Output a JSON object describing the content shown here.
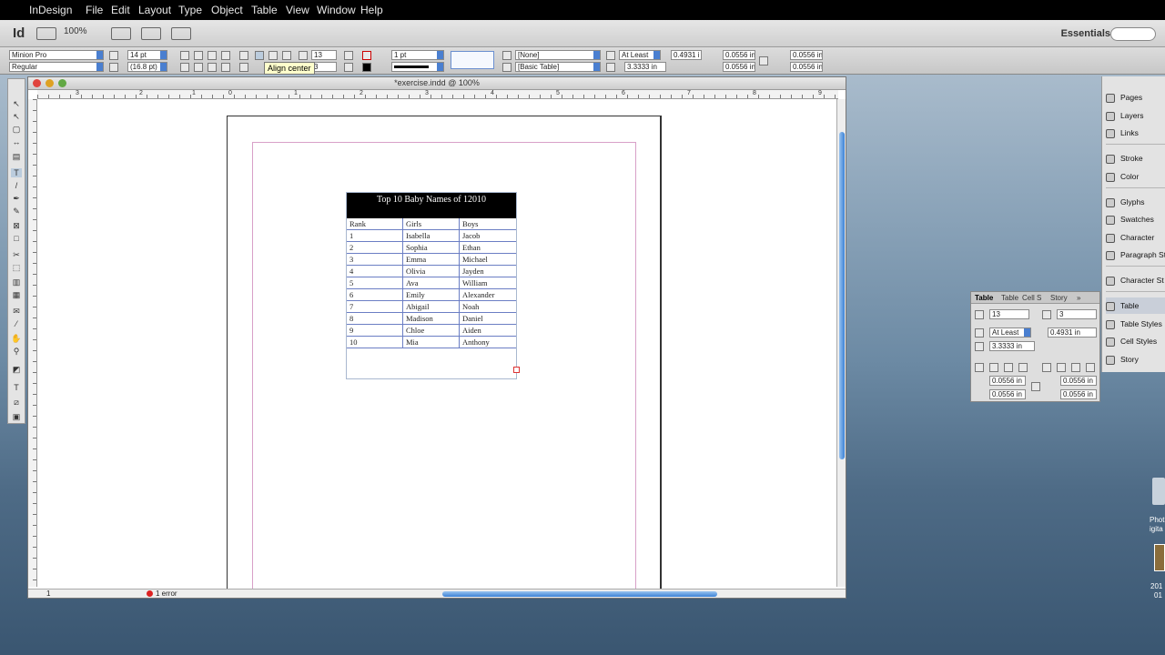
{
  "menubar": {
    "items": [
      "InDesign",
      "File",
      "Edit",
      "Layout",
      "Type",
      "Object",
      "Table",
      "View",
      "Window",
      "Help"
    ]
  },
  "appbar": {
    "logo": "Id",
    "zoom": "100%",
    "workspace": "Essentials"
  },
  "control": {
    "font_family": "Minion Pro",
    "font_style": "Regular",
    "font_size": "14 pt",
    "leading": "(16.8 pt)",
    "rows": "13",
    "cols": "3",
    "stroke_weight": "1 pt",
    "cell_style": "[None]",
    "table_style": "[Basic Table]",
    "row_height_mode": "At Least",
    "row_height": "0.4931 i",
    "col_width": "3.3333 in",
    "inset_top": "0.0556 in",
    "inset_bottom": "0.0556 in",
    "inset_left": "0.0556 in",
    "inset_right": "0.0556 in",
    "tooltip": "Align center"
  },
  "document": {
    "title": "*exercise.indd @ 100%",
    "page_number": "1",
    "errors": "1 error",
    "ruler_marks": [
      "3",
      "2",
      "1",
      "0",
      "1",
      "2",
      "3",
      "4",
      "5",
      "6",
      "7",
      "8",
      "9",
      "10",
      "11"
    ]
  },
  "table": {
    "title": "Top 10 Baby Names of 12010",
    "headers": [
      "Rank",
      "Girls",
      "Boys"
    ],
    "rows": [
      [
        "1",
        "Isabella",
        "Jacob"
      ],
      [
        "2",
        "Sophia",
        "Ethan"
      ],
      [
        "3",
        "Emma",
        "Michael"
      ],
      [
        "4",
        "Olivia",
        "Jayden"
      ],
      [
        "5",
        "Ava",
        "William"
      ],
      [
        "6",
        "Emily",
        "Alexander"
      ],
      [
        "7",
        "Abigail",
        "Noah"
      ],
      [
        "8",
        "Madison",
        "Daniel"
      ],
      [
        "9",
        "Chloe",
        "Aiden"
      ],
      [
        "10",
        "Mia",
        "Anthony"
      ]
    ]
  },
  "dock": {
    "items": [
      "Pages",
      "Layers",
      "Links",
      "Stroke",
      "Color",
      "Glyphs",
      "Swatches",
      "Character",
      "Paragraph St",
      "Character St",
      "Table",
      "Table Styles",
      "Cell Styles",
      "Story"
    ]
  },
  "table_panel": {
    "tabs": [
      "Table",
      "Table",
      "Cell S",
      "Story"
    ],
    "rows": "13",
    "cols": "3",
    "height_mode": "At Least",
    "height": "0.4931 in",
    "width": "3.3333 in",
    "inset_top": "0.0556 in",
    "inset_bottom": "0.0556 in",
    "inset_left": "0.0556 in",
    "inset_right": "0.0556 in"
  },
  "desktop": {
    "label1": "Phot",
    "label2": "igita",
    "label3": "201",
    "label4": "01"
  }
}
